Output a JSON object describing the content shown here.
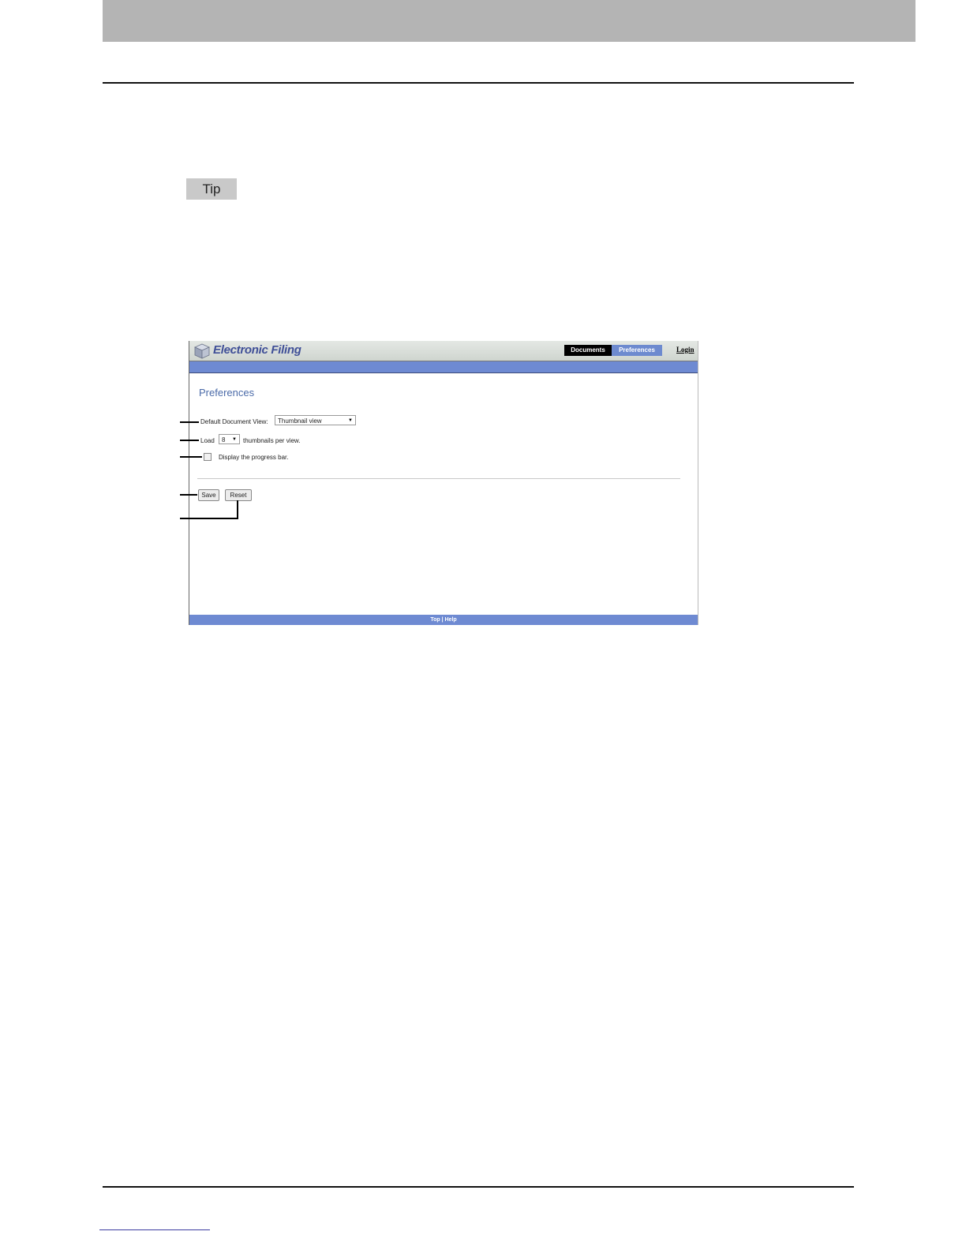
{
  "tip": {
    "label": "Tip"
  },
  "screenshot": {
    "app_title": "Electronic Filing",
    "tabs": {
      "documents": "Documents",
      "preferences": "Preferences"
    },
    "login": "Login",
    "page_title": "Preferences",
    "default_view": {
      "label": "Default Document View:",
      "value": "Thumbnail view"
    },
    "load": {
      "prefix": "Load",
      "value": "8",
      "suffix": "thumbnails per view."
    },
    "progress_bar": {
      "label": "Display the progress bar.",
      "checked": false
    },
    "buttons": {
      "save": "Save",
      "reset": "Reset"
    },
    "footer": {
      "top": "Top",
      "separator": "|",
      "help": "Help"
    }
  }
}
